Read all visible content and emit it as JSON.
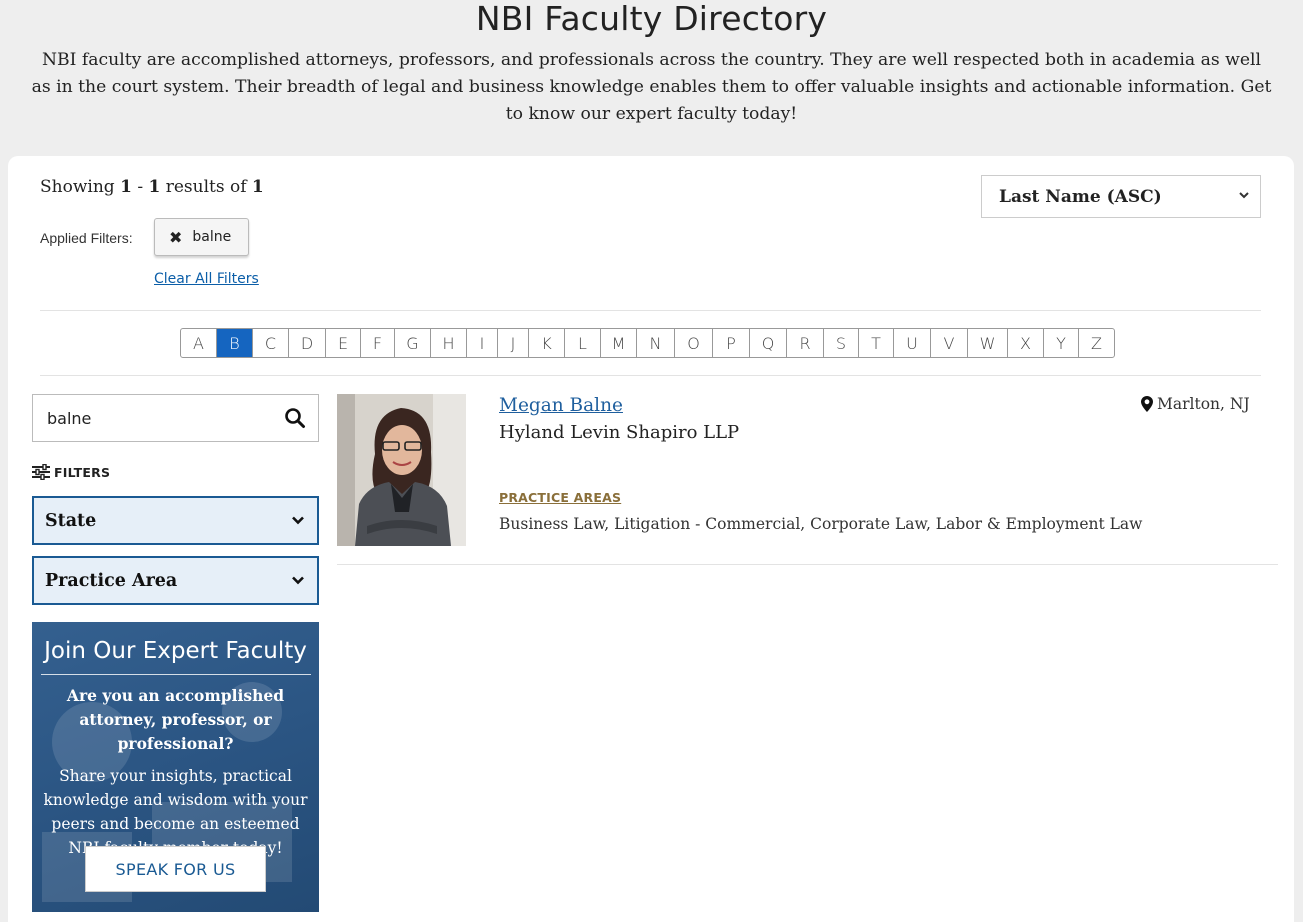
{
  "page": {
    "title": "NBI Faculty Directory",
    "intro": "NBI faculty are accomplished attorneys, professors, and professionals across the country. They are well respected both in academia as well as in the court system. Their breadth of legal and business knowledge enables them to offer valuable insights and actionable information. Get to know our expert faculty today!"
  },
  "results": {
    "showing_prefix": "Showing",
    "start": "1",
    "sep": "-",
    "end": "1",
    "results_of": "results of",
    "total": "1"
  },
  "filters": {
    "applied_label": "Applied Filters:",
    "chips": [
      {
        "icon": "close-icon",
        "label": "balne"
      }
    ],
    "clear_all": "Clear All Filters"
  },
  "sort": {
    "selected": "Last Name (ASC)"
  },
  "alphabet": {
    "letters": [
      "A",
      "B",
      "C",
      "D",
      "E",
      "F",
      "G",
      "H",
      "I",
      "J",
      "K",
      "L",
      "M",
      "N",
      "O",
      "P",
      "Q",
      "R",
      "S",
      "T",
      "U",
      "V",
      "W",
      "X",
      "Y",
      "Z"
    ],
    "active": "B"
  },
  "sidebar": {
    "search_value": "balne",
    "filters_heading": "FILTERS",
    "facets": [
      {
        "label": "State"
      },
      {
        "label": "Practice Area"
      }
    ],
    "promo": {
      "title": "Join Our Expert Faculty",
      "question": "Are you an accomplished attorney, professor, or professional?",
      "description": "Share your insights, practical knowledge and wisdom with your peers and become an esteemed NBI faculty member today!",
      "button": "SPEAK FOR US"
    }
  },
  "faculty": [
    {
      "name": "Megan Balne",
      "firm": "Hyland Levin Shapiro LLP",
      "location": "Marlton, NJ",
      "practice_areas_label": "PRACTICE AREAS",
      "practice_areas": "Business Law, Litigation - Commercial, Corporate Law, Labor & Employment Law"
    }
  ],
  "colors": {
    "accent": "#1565c0",
    "link": "#1f5f9e",
    "facet_border": "#1a5a93",
    "promo_bg": "#2b5583",
    "practice_label": "#8a6f3a"
  }
}
